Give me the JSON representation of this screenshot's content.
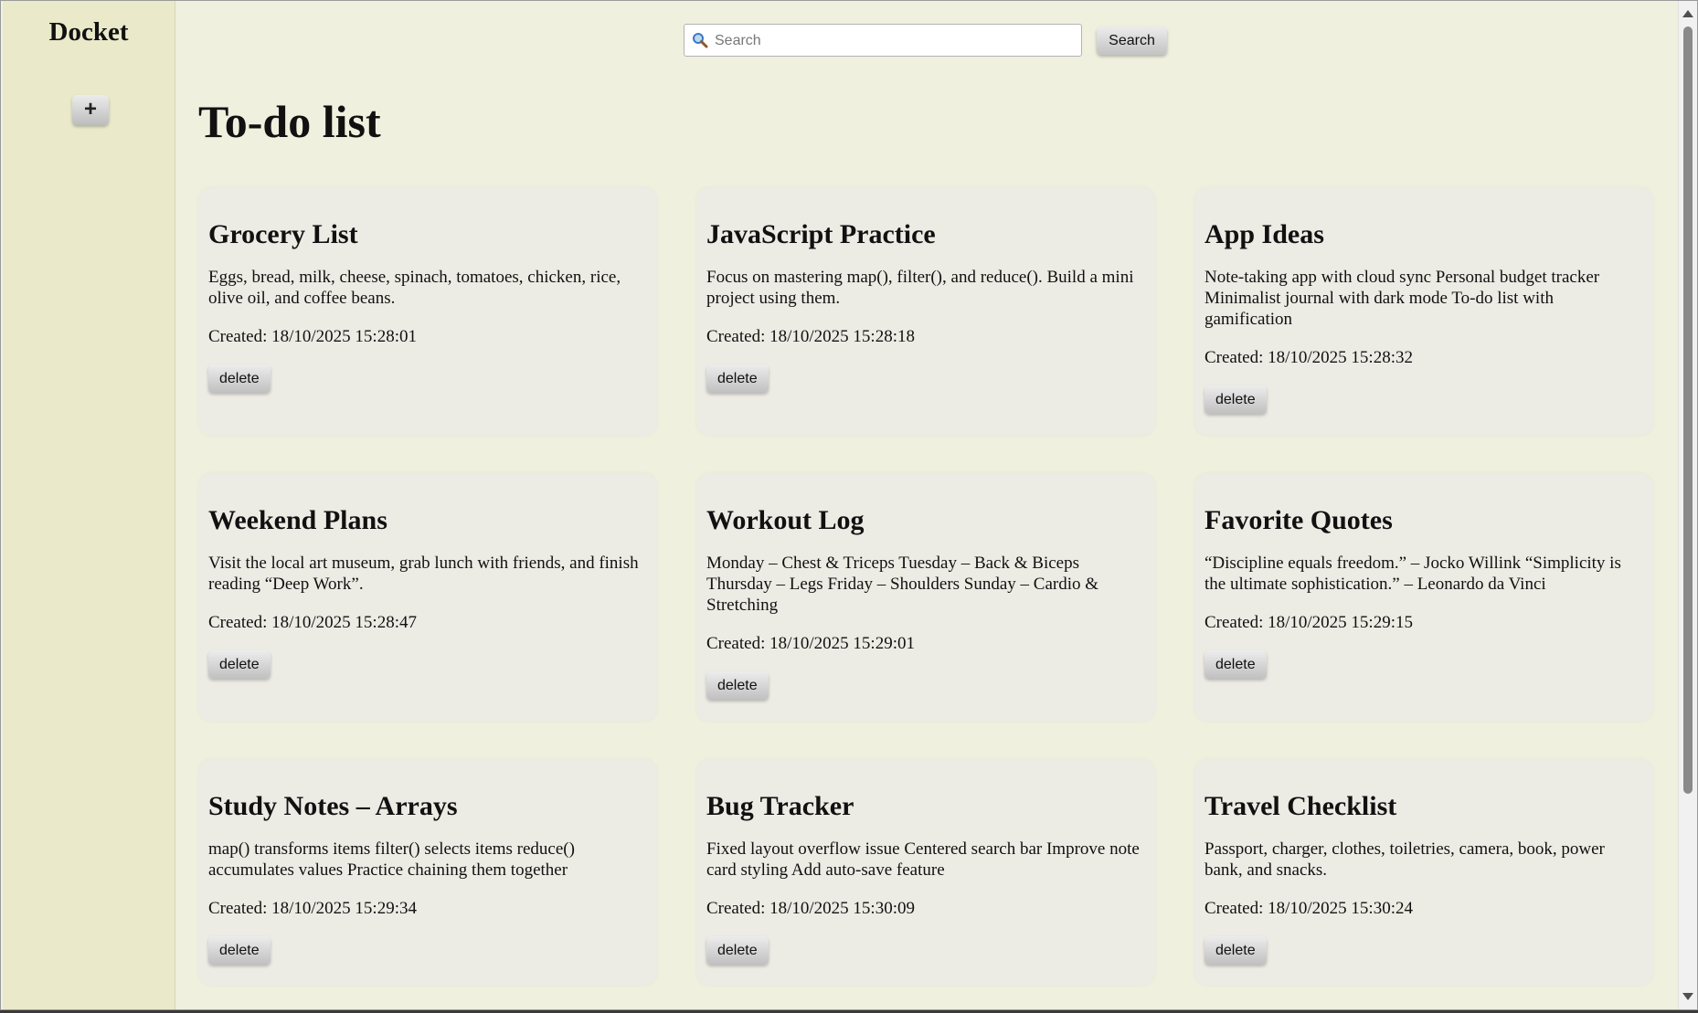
{
  "sidebar": {
    "brand": "Docket",
    "add_label": "+"
  },
  "search": {
    "placeholder": "Search",
    "button_label": "Search"
  },
  "page": {
    "title": "To-do list"
  },
  "notes": [
    {
      "title": "Grocery List",
      "body": "Eggs, bread, milk, cheese, spinach, tomatoes, chicken, rice, olive oil, and coffee beans.",
      "created": "Created: 18/10/2025 15:28:01",
      "delete_label": "delete"
    },
    {
      "title": "JavaScript Practice",
      "body": "Focus on mastering map(), filter(), and reduce(). Build a mini project using them.",
      "created": "Created: 18/10/2025 15:28:18",
      "delete_label": "delete"
    },
    {
      "title": "App Ideas",
      "body": "Note-taking app with cloud sync Personal budget tracker Minimalist journal with dark mode To-do list with gamification",
      "created": "Created: 18/10/2025 15:28:32",
      "delete_label": "delete"
    },
    {
      "title": "Weekend Plans",
      "body": "Visit the local art museum, grab lunch with friends, and finish reading “Deep Work”.",
      "created": "Created: 18/10/2025 15:28:47",
      "delete_label": "delete"
    },
    {
      "title": "Workout Log",
      "body": "Monday – Chest & Triceps Tuesday – Back & Biceps Thursday – Legs Friday – Shoulders Sunday – Cardio & Stretching",
      "created": "Created: 18/10/2025 15:29:01",
      "delete_label": "delete"
    },
    {
      "title": "Favorite Quotes",
      "body": "“Discipline equals freedom.” – Jocko Willink “Simplicity is the ultimate sophistication.” – Leonardo da Vinci",
      "created": "Created: 18/10/2025 15:29:15",
      "delete_label": "delete"
    },
    {
      "title": "Study Notes – Arrays",
      "body": "map() transforms items filter() selects items reduce() accumulates values Practice chaining them together",
      "created": "Created: 18/10/2025 15:29:34",
      "delete_label": "delete"
    },
    {
      "title": "Bug Tracker",
      "body": "Fixed layout overflow issue Centered search bar Improve note card styling Add auto-save feature",
      "created": "Created: 18/10/2025 15:30:09",
      "delete_label": "delete"
    },
    {
      "title": "Travel Checklist",
      "body": "Passport, charger, clothes, toiletries, camera, book, power bank, and snacks.",
      "created": "Created: 18/10/2025 15:30:24",
      "delete_label": "delete"
    }
  ]
}
